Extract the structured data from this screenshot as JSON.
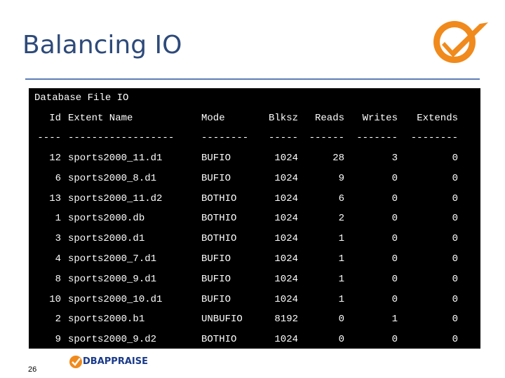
{
  "slide": {
    "title": "Balancing IO",
    "page_number": "26",
    "brand": "DBAPPRAISE",
    "accent_color": "#f08a1c"
  },
  "terminal": {
    "heading": "Database File IO",
    "columns": [
      "Id",
      "Extent Name",
      "Mode",
      "Blksz",
      "Reads",
      "Writes",
      "Extends"
    ],
    "underlines": [
      "----",
      "------------------",
      "--------",
      "-----",
      "------",
      "-------",
      "--------"
    ],
    "rows": [
      [
        "12",
        "sports2000_11.d1",
        "BUFIO",
        "1024",
        "28",
        "3",
        "0"
      ],
      [
        "6",
        "sports2000_8.d1",
        "BUFIO",
        "1024",
        "9",
        "0",
        "0"
      ],
      [
        "13",
        "sports2000_11.d2",
        "BOTHIO",
        "1024",
        "6",
        "0",
        "0"
      ],
      [
        "1",
        "sports2000.db",
        "BOTHIO",
        "1024",
        "2",
        "0",
        "0"
      ],
      [
        "3",
        "sports2000.d1",
        "BOTHIO",
        "1024",
        "1",
        "0",
        "0"
      ],
      [
        "4",
        "sports2000_7.d1",
        "BUFIO",
        "1024",
        "1",
        "0",
        "0"
      ],
      [
        "8",
        "sports2000_9.d1",
        "BUFIO",
        "1024",
        "1",
        "0",
        "0"
      ],
      [
        "10",
        "sports2000_10.d1",
        "BUFIO",
        "1024",
        "1",
        "0",
        "0"
      ],
      [
        "2",
        "sports2000.b1",
        "UNBUFIO",
        "8192",
        "0",
        "1",
        "0"
      ],
      [
        "9",
        "sports2000_9.d2",
        "BOTHIO",
        "1024",
        "0",
        "0",
        "0"
      ]
    ]
  }
}
